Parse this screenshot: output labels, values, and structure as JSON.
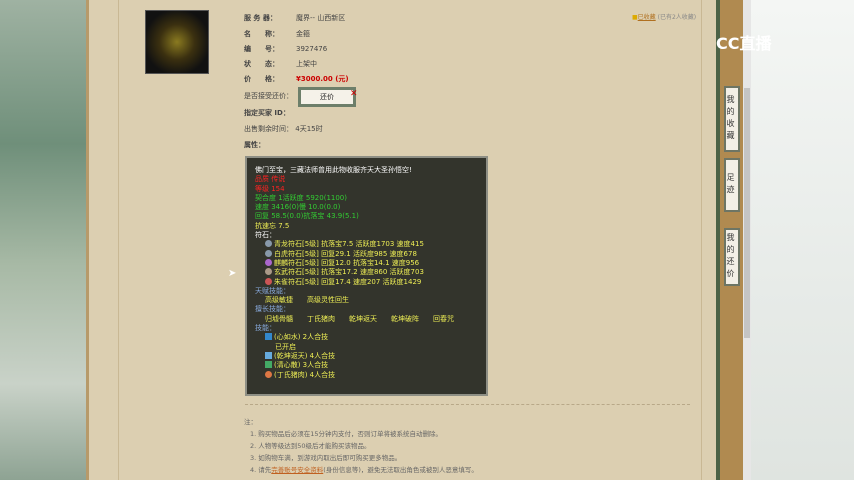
{
  "info": {
    "server_label": "服 务 器：",
    "server": "魔界-- 山西新区",
    "name_label": "名　　称：",
    "name": "金箍",
    "id_label": "编　　号：",
    "id": "3927476",
    "status_label": "状　　态：",
    "status": "上架中",
    "price_label": "价　　格：",
    "price": "¥3000.00 (元)",
    "bargain_label": "是否接受还价：",
    "bargain_button": "还价",
    "bargain_x": "✕",
    "buyer_label": "指定买家 ID：",
    "time_label": "出售剩余时间：",
    "time": "4天15时",
    "attr_label": "属性："
  },
  "favorite": {
    "link": "已收藏",
    "count": "(已有2人收藏)"
  },
  "attrs": {
    "desc": "佛门至宝，三藏法师曾用此物收服齐天大圣孙悟空!",
    "red": [
      "品质  传说",
      "等级  154"
    ],
    "green": [
      "契合度      1活跃度   5920(1100)",
      "速度      3416(0)慢       10.0(0.0)",
      "回复      58.5(0.0)抗落宝   43.9(5.1)"
    ],
    "resist": "抗速忘 7.5",
    "rune_label": "符石：",
    "runes": [
      "青龙符石[5级] 抗落宝7.5 活跃度1703 速度415",
      "白虎符石[5级] 回复29.1 活跃度985 速度678",
      "麒麟符石[5级] 回复12.0 抗落宝14.1 速度956",
      "玄武符石[5级] 抗落宝17.2 速度860 活跃度703",
      "朱雀符石[5级] 回复17.4 速度207 活跃度1429"
    ],
    "talent_label": "天赋技能：",
    "talents": "高级敏捷　　高级灵性回生",
    "special_label": "擅长技能：",
    "specials": "归墟骨髓　　丁氏猪肉　　乾坤返天　　乾坤破阵　　回春咒",
    "skill_label": "技能：",
    "skills": [
      "(心如水) 2人合技",
      "已开启",
      "(乾坤返天) 4人合技",
      "(清心散) 3人合技",
      "(丁氏猪肉) 4人合技"
    ]
  },
  "notes": {
    "title": "注：",
    "items": [
      "1. 购买物品后必须在15分钟内支付，否则订单将被系统自动删除。",
      "2. 人物等级达到50级后才能购买该物品。",
      "3. 如购物车满，到游戏内取出后即可购买更多物品。"
    ],
    "item4_pre": "4. 请先",
    "item4_link": "完善账号安全资料",
    "item4_post": "(身份信息等)，避免无法取出角色或被别人恶意填写。"
  },
  "side": {
    "fav": "我的收藏",
    "track": "足迹",
    "bargain": "我的还价"
  },
  "logo": "CC直播"
}
